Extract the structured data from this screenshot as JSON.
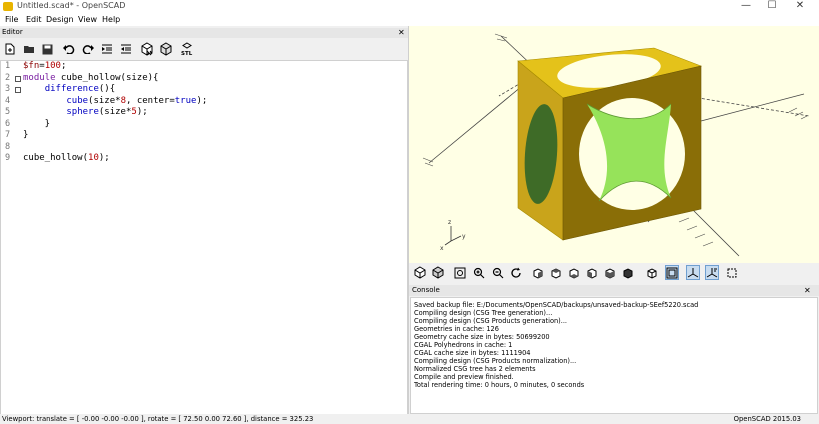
{
  "window": {
    "title": "Untitled.scad* - OpenSCAD",
    "minimize": "—",
    "maximize": "☐",
    "close": "✕"
  },
  "menu": [
    "File",
    "Edit",
    "Design",
    "View",
    "Help"
  ],
  "editor": {
    "title": "Editor",
    "lines": [
      {
        "num": "1",
        "text": "$fn=100;"
      },
      {
        "num": "2",
        "text": "module cube_hollow(size){"
      },
      {
        "num": "3",
        "text": "    difference(){"
      },
      {
        "num": "4",
        "text": "        cube(size*8, center=true);"
      },
      {
        "num": "5",
        "text": "        sphere(size*5);"
      },
      {
        "num": "6",
        "text": "    }"
      },
      {
        "num": "7",
        "text": "}"
      },
      {
        "num": "8",
        "text": ""
      },
      {
        "num": "9",
        "text": "cube_hollow(10);"
      }
    ]
  },
  "console": {
    "title": "Console",
    "lines": [
      "Saved backup file: E:/Documents/OpenSCAD/backups/unsaved-backup-SEef5220.scad",
      "Compiling design (CSG Tree generation)...",
      "Compiling design (CSG Products generation)...",
      "Geometries in cache: 126",
      "Geometry cache size in bytes: 50699200",
      "CGAL Polyhedrons in cache: 1",
      "CGAL cache size in bytes: 1111904",
      "Compiling design (CSG Products normalization)...",
      "Normalized CSG tree has 2 elements",
      "Compile and preview finished.",
      "Total rendering time: 0 hours, 0 minutes, 0 seconds"
    ]
  },
  "status": {
    "viewport": "Viewport: translate = [ -0.00 -0.00 -0.00 ], rotate = [ 72.50 0.00 72.60 ], distance = 325.23",
    "version": "OpenSCAD 2015.03"
  },
  "axes": {
    "x": "x",
    "y": "y",
    "z": "z"
  },
  "colors": {
    "model_face": "#e8c21a",
    "model_cut": "#96e35a",
    "viewport_bg": "#ffffe5"
  }
}
